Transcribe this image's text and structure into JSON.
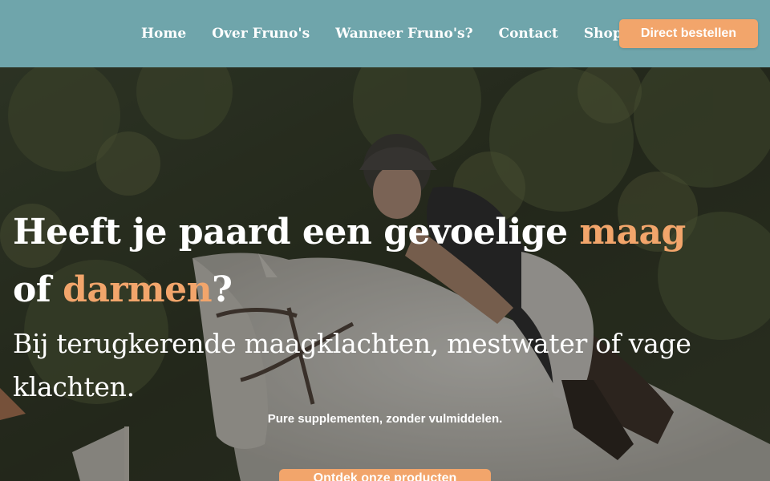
{
  "nav": {
    "items": [
      {
        "label": "Home"
      },
      {
        "label": "Over Fruno's"
      },
      {
        "label": "Wanneer Fruno's?"
      },
      {
        "label": "Contact"
      },
      {
        "label": "Shop"
      }
    ],
    "cta_label": "Direct bestellen"
  },
  "hero": {
    "headline": {
      "part1": "Heeft je paard een gevoelige ",
      "accent1": "maag",
      "part2": " of ",
      "accent2": "darmen",
      "part3": "?"
    },
    "subheadline": "Bij terugkerende maagklachten, mestwater of vage klachten.",
    "tagline": "Pure supplementen, zonder vulmiddelen.",
    "cta_label": "Ontdek onze producten",
    "image_alt": "Ruiter springt met een schimmel over een hindernis"
  },
  "colors": {
    "header_bg": "#6fa5ab",
    "accent": "#f2a56b",
    "text": "#ffffff"
  }
}
